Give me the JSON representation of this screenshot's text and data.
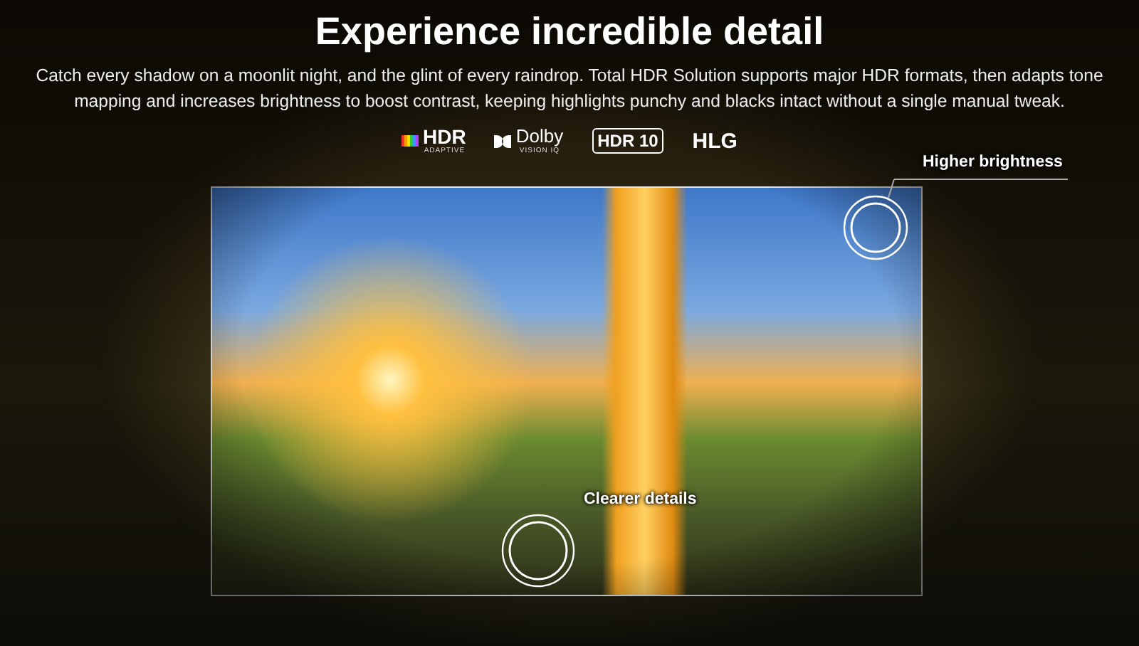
{
  "headline": "Experience incredible detail",
  "description": "Catch every shadow on a moonlit night, and the glint of every raindrop. Total HDR Solution supports major HDR formats, then adapts tone mapping and increases brightness to boost contrast, keeping highlights punchy and blacks intact without a single manual tweak.",
  "format_logos": [
    {
      "kind": "hdr-adaptive",
      "label": "HDR",
      "sublabel": "ADAPTIVE"
    },
    {
      "kind": "dolby",
      "label": "Dolby",
      "sublabel": "VISION IQ"
    },
    {
      "kind": "boxed",
      "label": "HDR 10"
    },
    {
      "kind": "plain",
      "label": "HLG"
    }
  ],
  "callouts": [
    {
      "label": "Higher brightness"
    },
    {
      "label": "Clearer details"
    }
  ]
}
